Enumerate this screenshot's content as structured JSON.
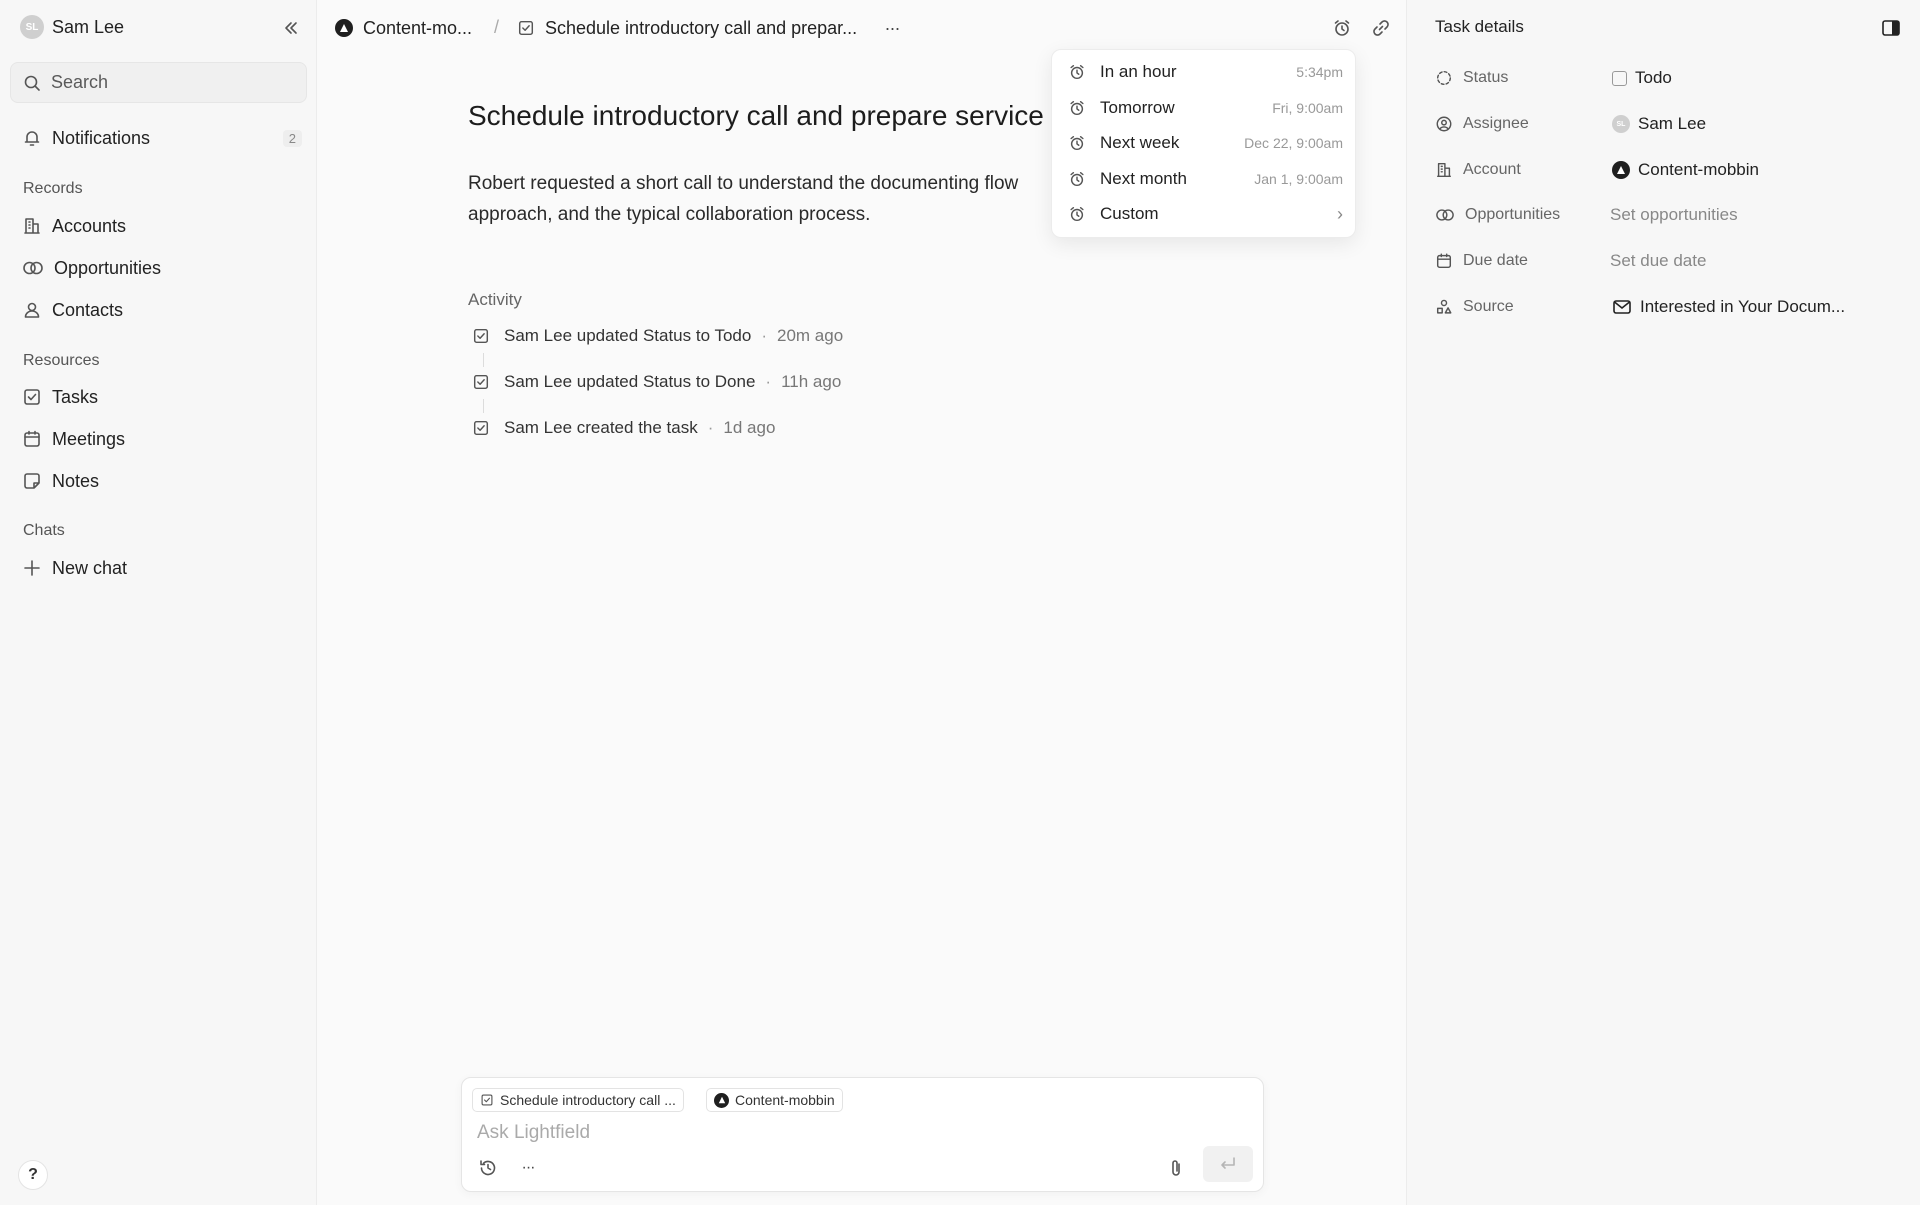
{
  "sidebar": {
    "user": {
      "initials": "SL",
      "name": "Sam Lee"
    },
    "search_placeholder": "Search",
    "notifications": {
      "label": "Notifications",
      "count": "2"
    },
    "sections": {
      "records": "Records",
      "resources": "Resources",
      "chats": "Chats"
    },
    "records": [
      {
        "label": "Accounts",
        "icon": "building-icon"
      },
      {
        "label": "Opportunities",
        "icon": "linked-circles-icon"
      },
      {
        "label": "Contacts",
        "icon": "person-icon"
      }
    ],
    "resources": [
      {
        "label": "Tasks",
        "icon": "checkbox-icon"
      },
      {
        "label": "Meetings",
        "icon": "calendar-icon"
      },
      {
        "label": "Notes",
        "icon": "note-icon"
      }
    ],
    "new_chat": "New chat",
    "help": "?"
  },
  "header": {
    "breadcrumb_account": "Content-mo...",
    "breadcrumb_separator": "/",
    "breadcrumb_task": "Schedule introductory call and prepar...",
    "more": "···"
  },
  "task": {
    "title": "Schedule introductory call and prepare service",
    "description": "Robert requested a short call to understand the documenting flow approach, and the typical collaboration process."
  },
  "activity": {
    "label": "Activity",
    "items": [
      {
        "text": "Sam Lee updated Status to Todo",
        "time": "20m ago"
      },
      {
        "text": "Sam Lee updated Status to Done",
        "time": "11h ago"
      },
      {
        "text": "Sam Lee created the task",
        "time": "1d ago"
      }
    ],
    "separator": "·"
  },
  "reminder_menu": {
    "items": [
      {
        "label": "In an hour",
        "time": "5:34pm"
      },
      {
        "label": "Tomorrow",
        "time": "Fri, 9:00am"
      },
      {
        "label": "Next week",
        "time": "Dec 22, 9:00am"
      },
      {
        "label": "Next month",
        "time": "Jan 1, 9:00am"
      },
      {
        "label": "Custom",
        "time": "›"
      }
    ]
  },
  "details": {
    "title": "Task details",
    "status": {
      "label": "Status",
      "value": "Todo"
    },
    "assignee": {
      "label": "Assignee",
      "value": "Sam Lee",
      "initials": "SL"
    },
    "account": {
      "label": "Account",
      "value": "Content-mobbin"
    },
    "opportunities": {
      "label": "Opportunities",
      "value": "Set opportunities"
    },
    "due_date": {
      "label": "Due date",
      "value": "Set due date"
    },
    "source": {
      "label": "Source",
      "value": "Interested in Your Docum..."
    }
  },
  "composer": {
    "chip_task": "Schedule introductory call ...",
    "chip_account": "Content-mobbin",
    "placeholder": "Ask Lightfield",
    "more": "···"
  },
  "colors": {
    "accent_dark": "#1f1f1f",
    "muted": "#888888",
    "background": "#fafafa"
  }
}
